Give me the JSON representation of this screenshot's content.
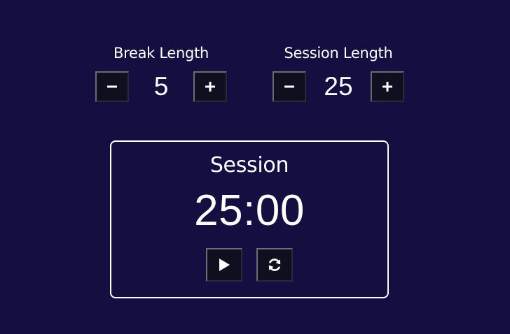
{
  "break": {
    "label": "Break Length",
    "value": "5",
    "decrement_label": "−",
    "increment_label": "+"
  },
  "session": {
    "label": "Session Length",
    "value": "25",
    "decrement_label": "−",
    "increment_label": "+"
  },
  "timer": {
    "label": "Session",
    "time_left": "25:00",
    "start_stop_icon": "play-icon",
    "reset_icon": "refresh-icon"
  },
  "colors": {
    "background": "#130f40",
    "text": "#ffffff",
    "button_bg": "#0f0f1f",
    "border": "#ffffff"
  }
}
